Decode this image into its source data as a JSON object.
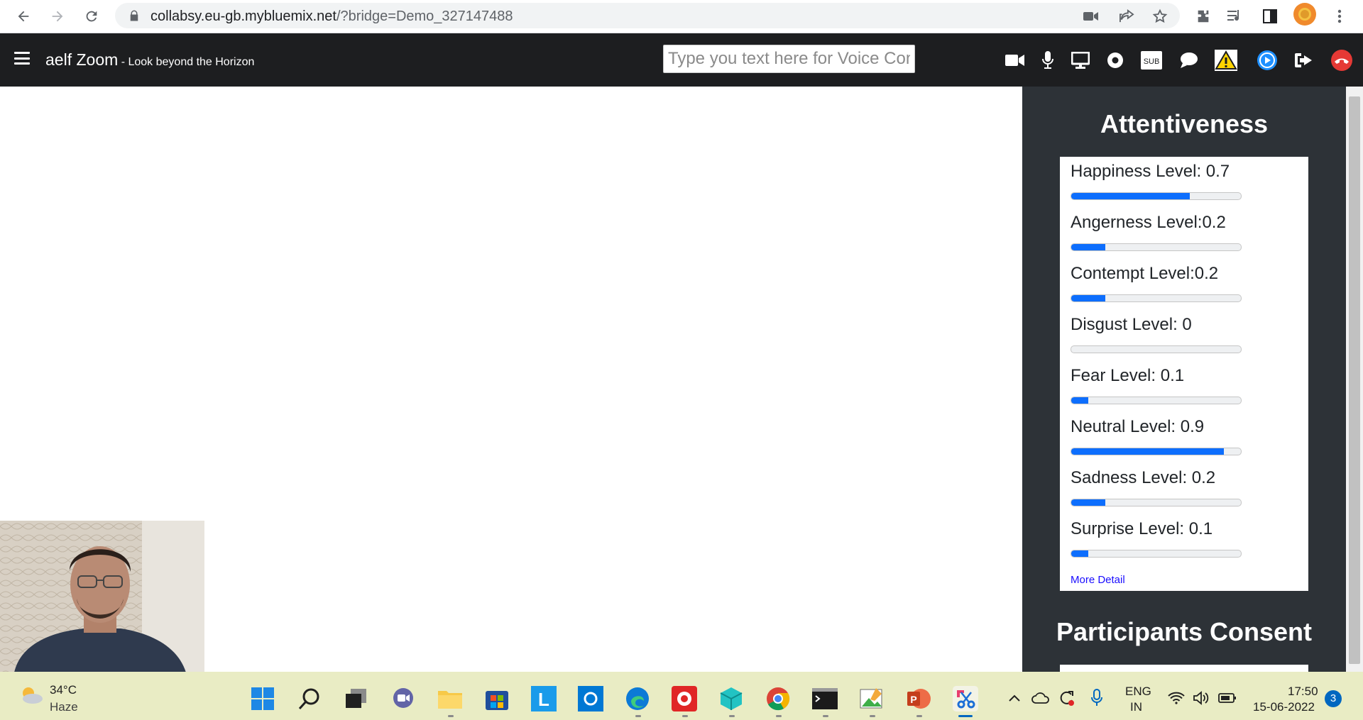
{
  "browser": {
    "url_host": "collabsy.eu-gb.mybluemix.net",
    "url_path": "/?bridge=Demo_327147488",
    "icons": [
      "back-arrow-icon",
      "forward-arrow-icon",
      "reload-icon",
      "lock-icon",
      "camera-icon",
      "share-icon",
      "star-icon",
      "extensions-icon",
      "reading-list-icon",
      "sidepanel-icon",
      "profile-avatar",
      "more-vert-icon"
    ]
  },
  "header": {
    "title": "aelf Zoom",
    "tagline": " - Look beyond the Horizon",
    "voice_placeholder": "Type you text here for Voice Conversion",
    "sub_label": "SUB",
    "tools": [
      "video-icon",
      "microphone-icon",
      "screen-share-icon",
      "record-icon",
      "subtitles-icon",
      "chat-icon",
      "warning-icon",
      "play-circle-icon",
      "exit-icon",
      "end-call-icon"
    ],
    "accent_colors": {
      "warning": "#ffd400",
      "play": "#1e90ff",
      "end_call": "#e53935"
    }
  },
  "panel": {
    "attentiveness_title": "Attentiveness",
    "metrics": [
      {
        "label": "Happiness Level: 0.7",
        "value": 0.7
      },
      {
        "label": "Angerness Level:0.2",
        "value": 0.2
      },
      {
        "label": "Contempt Level:0.2",
        "value": 0.2
      },
      {
        "label": "Disgust Level: 0",
        "value": 0
      },
      {
        "label": "Fear Level: 0.1",
        "value": 0.1
      },
      {
        "label": "Neutral Level: 0.9",
        "value": 0.9
      },
      {
        "label": "Sadness Level: 0.2",
        "value": 0.2
      },
      {
        "label": "Surprise Level: 0.1",
        "value": 0.1
      }
    ],
    "more_detail": "More Detail",
    "consent_title": "Participants Consent",
    "progress_color": "#0d6efd"
  },
  "taskbar": {
    "temperature": "34°C",
    "weather": "Haze",
    "lang_line1": "ENG",
    "lang_line2": "IN",
    "time": "17:50",
    "date": "15-06-2022",
    "notifications": "3",
    "apps": [
      "windows-start-icon",
      "search-icon",
      "task-view-icon",
      "teams-chat-icon",
      "file-explorer-icon",
      "store-icon",
      "l-app-icon",
      "cortana-icon",
      "edge-icon",
      "red-app-icon",
      "cube-app-icon",
      "chrome-icon",
      "terminal-icon",
      "paint-icon",
      "powerpoint-icon",
      "snipping-tool-icon"
    ],
    "tray": [
      "chevron-up-icon",
      "onedrive-icon",
      "sync-icon",
      "microphone-tray-icon",
      "wifi-icon",
      "volume-icon",
      "battery-icon"
    ]
  }
}
